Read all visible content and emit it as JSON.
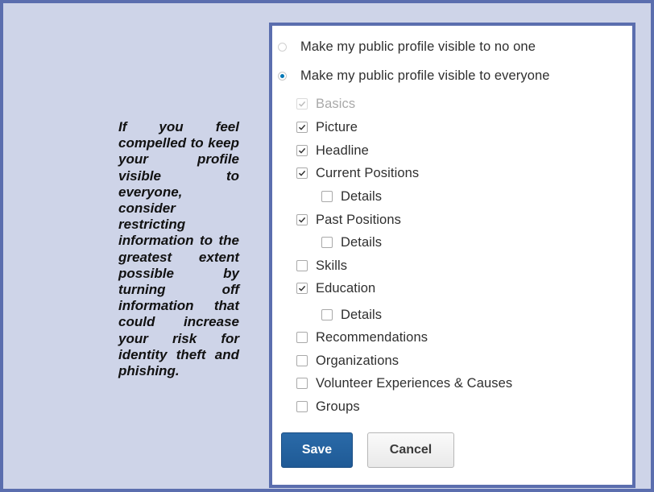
{
  "note": {
    "text": "If you feel compelled to keep your profile visible to everyone, consider restricting information to the greatest extent possible by turning off information that could increase your risk for identity theft and phishing."
  },
  "visibility": {
    "options": [
      {
        "label": "Make my public profile visible to no one",
        "selected": false
      },
      {
        "label": "Make my public profile visible to everyone",
        "selected": true
      }
    ]
  },
  "sections": [
    {
      "label": "Basics",
      "checked": true,
      "disabled": true
    },
    {
      "label": "Picture",
      "checked": true
    },
    {
      "label": "Headline",
      "checked": true
    },
    {
      "label": "Current Positions",
      "checked": true
    },
    {
      "label": "Details",
      "checked": false,
      "sub": true
    },
    {
      "label": "Past Positions",
      "checked": true
    },
    {
      "label": "Details",
      "checked": false,
      "sub": true
    },
    {
      "label": "Skills",
      "checked": false
    },
    {
      "label": "Education",
      "checked": true
    },
    {
      "label": "Details",
      "checked": false,
      "sub": true
    },
    {
      "label": "Recommendations",
      "checked": false
    },
    {
      "label": "Organizations",
      "checked": false
    },
    {
      "label": "Volunteer Experiences & Causes",
      "checked": false
    },
    {
      "label": "Groups",
      "checked": false
    }
  ],
  "actions": {
    "save_label": "Save",
    "cancel_label": "Cancel"
  },
  "colors": {
    "frame_border": "#5b6eae",
    "frame_fill": "#ced4e8",
    "primary_button": "#1f5a96",
    "radio_selected": "#0077b5"
  }
}
